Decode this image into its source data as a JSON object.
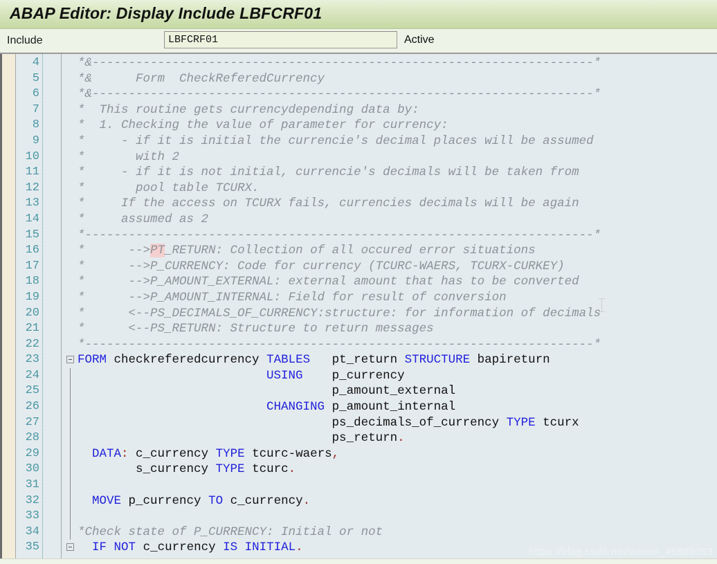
{
  "window": {
    "title": "ABAP Editor: Display Include LBFCRF01"
  },
  "toolbar": {
    "include_label": "Include",
    "include_value": "LBFCRF01",
    "include_placeholder": "",
    "status_label": "Active"
  },
  "editor": {
    "first_line": 4,
    "caret_line": 16,
    "search_highlight": "PT",
    "watermark": "https://blog.csdn.net/weixin_45689053",
    "colors": {
      "title_bar": "#c6d9a3",
      "toolbar": "#eef3e7",
      "code_background": "#e4ebee",
      "gutter_strip": "#f2ecd9",
      "line_number": "#4a97a4",
      "comment": "#8d9499",
      "keyword": "#2222dd",
      "identifier": "#111111",
      "punctuation": "#9d2b2b",
      "highlight": "#f5cfcf"
    },
    "lines": [
      {
        "n": 4,
        "type": "comment",
        "text": "*&---------------------------------------------------------------------*"
      },
      {
        "n": 5,
        "type": "comment",
        "text": "*&      Form  CheckReferedCurrency"
      },
      {
        "n": 6,
        "type": "comment",
        "text": "*&---------------------------------------------------------------------*"
      },
      {
        "n": 7,
        "type": "comment",
        "text": "*  This routine gets currencydepending data by:"
      },
      {
        "n": 8,
        "type": "comment",
        "text": "*  1. Checking the value of parameter for currency:"
      },
      {
        "n": 9,
        "type": "comment",
        "text": "*     - if it is initial the currencie's decimal places will be assumed"
      },
      {
        "n": 10,
        "type": "comment",
        "text": "*       with 2"
      },
      {
        "n": 11,
        "type": "comment",
        "text": "*     - if it is not initial, currencie's decimals will be taken from"
      },
      {
        "n": 12,
        "type": "comment",
        "text": "*       pool table TCURX."
      },
      {
        "n": 13,
        "type": "comment",
        "text": "*     If the access on TCURX fails, currencies decimals will be again"
      },
      {
        "n": 14,
        "type": "comment",
        "text": "*     assumed as 2"
      },
      {
        "n": 15,
        "type": "comment",
        "text": "*----------------------------------------------------------------------*"
      },
      {
        "n": 16,
        "type": "comment",
        "text": "*      -->PT_RETURN: Collection of all occured error situations"
      },
      {
        "n": 17,
        "type": "comment",
        "text": "*      -->P_CURRENCY: Code for currency (TCURC-WAERS, TCURX-CURKEY)"
      },
      {
        "n": 18,
        "type": "comment",
        "text": "*      -->P_AMOUNT_EXTERNAL: external amount that has to be converted"
      },
      {
        "n": 19,
        "type": "comment",
        "text": "*      -->P_AMOUNT_INTERNAL: Field for result of conversion"
      },
      {
        "n": 20,
        "type": "comment",
        "text": "*      <--PS_DECIMALS_OF_CURRENCY:structure: for information of decimals"
      },
      {
        "n": 21,
        "type": "comment",
        "text": "*      <--PS_RETURN: Structure to return messages"
      },
      {
        "n": 22,
        "type": "comment",
        "text": "*----------------------------------------------------------------------*"
      },
      {
        "n": 23,
        "type": "code",
        "text": "FORM checkreferedcurrency TABLES   pt_return STRUCTURE bapireturn"
      },
      {
        "n": 24,
        "type": "code",
        "text": "                          USING    p_currency"
      },
      {
        "n": 25,
        "type": "code",
        "text": "                                   p_amount_external"
      },
      {
        "n": 26,
        "type": "code",
        "text": "                          CHANGING p_amount_internal"
      },
      {
        "n": 27,
        "type": "code",
        "text": "                                   ps_decimals_of_currency TYPE tcurx"
      },
      {
        "n": 28,
        "type": "code",
        "text": "                                   ps_return."
      },
      {
        "n": 29,
        "type": "code",
        "text": "  DATA: c_currency TYPE tcurc-waers,"
      },
      {
        "n": 30,
        "type": "code",
        "text": "        s_currency TYPE tcurc."
      },
      {
        "n": 31,
        "type": "code",
        "text": ""
      },
      {
        "n": 32,
        "type": "code",
        "text": "  MOVE p_currency TO c_currency."
      },
      {
        "n": 33,
        "type": "code",
        "text": ""
      },
      {
        "n": 34,
        "type": "comment",
        "text": "*Check state of P_CURRENCY: Initial or not"
      },
      {
        "n": 35,
        "type": "code",
        "text": "  IF NOT c_currency IS INITIAL."
      }
    ]
  }
}
